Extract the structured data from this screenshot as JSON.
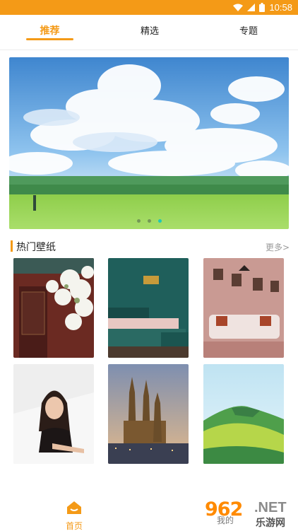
{
  "status_bar": {
    "time": "10:58",
    "icons": [
      "wifi-icon",
      "signal-icon",
      "battery-icon"
    ]
  },
  "tabs": [
    {
      "label": "推荐",
      "active": true
    },
    {
      "label": "精选",
      "active": false
    },
    {
      "label": "专题",
      "active": false
    }
  ],
  "banner": {
    "slides": 3,
    "active_slide": 3
  },
  "section": {
    "title": "热门壁纸",
    "more": "更多>"
  },
  "wallpapers": [
    {
      "subject": "white blossoms and red palace gate"
    },
    {
      "subject": "teal bedroom interior"
    },
    {
      "subject": "pink living room with sofa"
    },
    {
      "subject": "portrait of woman"
    },
    {
      "subject": "cathedral at dusk"
    },
    {
      "subject": "green mountain landscape"
    }
  ],
  "bottom_nav": {
    "home": "首页",
    "mine": "我的"
  },
  "watermark": {
    "logo": "962",
    "net": ".NET",
    "sub": "乐游网"
  },
  "colors": {
    "accent": "#f49a17",
    "dot_active": "#1fc8b5"
  }
}
